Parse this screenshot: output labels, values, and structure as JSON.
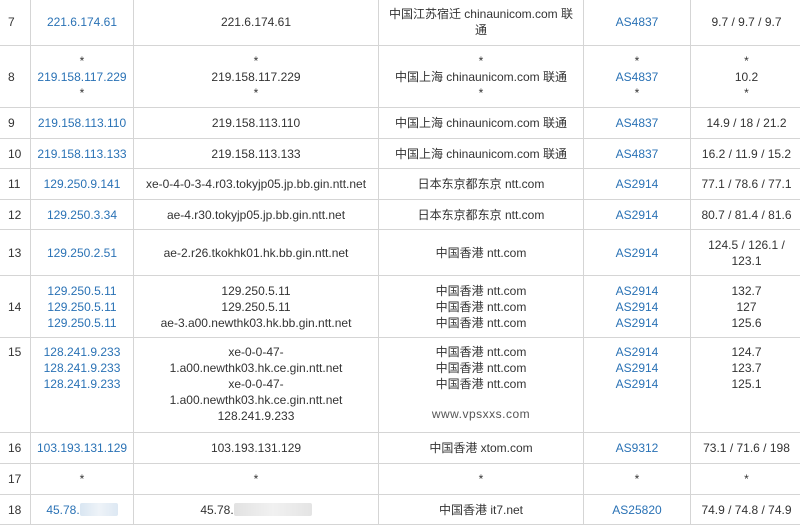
{
  "rows": [
    {
      "hop": "7",
      "ips": [
        "221.6.174.61"
      ],
      "hosts": [
        "221.6.174.61"
      ],
      "locs": [
        "中国江苏宿迁 chinaunicom.com 联通"
      ],
      "asns": [
        "AS4837"
      ],
      "rtts": [
        "9.7 / 9.7 / 9.7"
      ]
    },
    {
      "hop": "8",
      "ips": [
        "*",
        "219.158.117.229",
        "*"
      ],
      "hosts": [
        "*",
        "219.158.117.229",
        "*"
      ],
      "locs": [
        "*",
        "中国上海 chinaunicom.com 联通",
        "*"
      ],
      "asns": [
        "*",
        "AS4837",
        "*"
      ],
      "rtts": [
        "*",
        "10.2",
        "*"
      ]
    },
    {
      "hop": "9",
      "ips": [
        "219.158.113.110"
      ],
      "hosts": [
        "219.158.113.110"
      ],
      "locs": [
        "中国上海 chinaunicom.com 联通"
      ],
      "asns": [
        "AS4837"
      ],
      "rtts": [
        "14.9 / 18 / 21.2"
      ]
    },
    {
      "hop": "10",
      "ips": [
        "219.158.113.133"
      ],
      "hosts": [
        "219.158.113.133"
      ],
      "locs": [
        "中国上海 chinaunicom.com 联通"
      ],
      "asns": [
        "AS4837"
      ],
      "rtts": [
        "16.2 / 11.9 / 15.2"
      ]
    },
    {
      "hop": "11",
      "ips": [
        "129.250.9.141"
      ],
      "hosts": [
        "xe-0-4-0-3-4.r03.tokyjp05.jp.bb.gin.ntt.net"
      ],
      "locs": [
        "日本东京都东京 ntt.com"
      ],
      "asns": [
        "AS2914"
      ],
      "rtts": [
        "77.1 / 78.6 / 77.1"
      ]
    },
    {
      "hop": "12",
      "ips": [
        "129.250.3.34"
      ],
      "hosts": [
        "ae-4.r30.tokyjp05.jp.bb.gin.ntt.net"
      ],
      "locs": [
        "日本东京都东京 ntt.com"
      ],
      "asns": [
        "AS2914"
      ],
      "rtts": [
        "80.7 / 81.4 / 81.6"
      ]
    },
    {
      "hop": "13",
      "ips": [
        "129.250.2.51"
      ],
      "hosts": [
        "ae-2.r26.tkokhk01.hk.bb.gin.ntt.net"
      ],
      "locs": [
        "中国香港 ntt.com"
      ],
      "asns": [
        "AS2914"
      ],
      "rtts": [
        "124.5 / 126.1 / 123.1"
      ]
    },
    {
      "hop": "14",
      "ips": [
        "129.250.5.11",
        "129.250.5.11",
        "129.250.5.11"
      ],
      "hosts": [
        "129.250.5.11",
        "129.250.5.11",
        "ae-3.a00.newthk03.hk.bb.gin.ntt.net"
      ],
      "locs": [
        "中国香港 ntt.com",
        "中国香港 ntt.com",
        "中国香港 ntt.com"
      ],
      "asns": [
        "AS2914",
        "AS2914",
        "AS2914"
      ],
      "rtts": [
        "132.7",
        "127",
        "125.6"
      ]
    },
    {
      "hop": "15",
      "ips": [
        "128.241.9.233",
        "128.241.9.233",
        "128.241.9.233"
      ],
      "hosts": [
        "xe-0-0-47-",
        "1.a00.newthk03.hk.ce.gin.ntt.net",
        "xe-0-0-47-",
        "1.a00.newthk03.hk.ce.gin.ntt.net",
        "128.241.9.233"
      ],
      "locs": [
        "中国香港 ntt.com",
        "中国香港 ntt.com",
        "中国香港 ntt.com"
      ],
      "asns": [
        "AS2914",
        "AS2914",
        "AS2914"
      ],
      "rtts": [
        "124.7",
        "123.7",
        "125.1"
      ],
      "watermark": "www.vpsxxs.com"
    },
    {
      "hop": "16",
      "ips": [
        "103.193.131.129"
      ],
      "hosts": [
        "103.193.131.129"
      ],
      "locs": [
        "中国香港 xtom.com"
      ],
      "asns": [
        "AS9312"
      ],
      "rtts": [
        "73.1 / 71.6 / 198"
      ]
    },
    {
      "hop": "17",
      "ips": [
        "*"
      ],
      "hosts": [
        "*"
      ],
      "locs": [
        "*"
      ],
      "asns": [
        "*"
      ],
      "rtts": [
        "*"
      ]
    },
    {
      "hop": "18",
      "ips": [
        "45.78."
      ],
      "hosts": [
        "45.78."
      ],
      "locs": [
        "中国香港 it7.net"
      ],
      "asns": [
        "AS25820"
      ],
      "rtts": [
        "74.9 / 74.8 / 74.9"
      ]
    }
  ],
  "colors": {
    "link": "#2a72b5",
    "text": "#333333",
    "border": "#d5d5d5"
  }
}
